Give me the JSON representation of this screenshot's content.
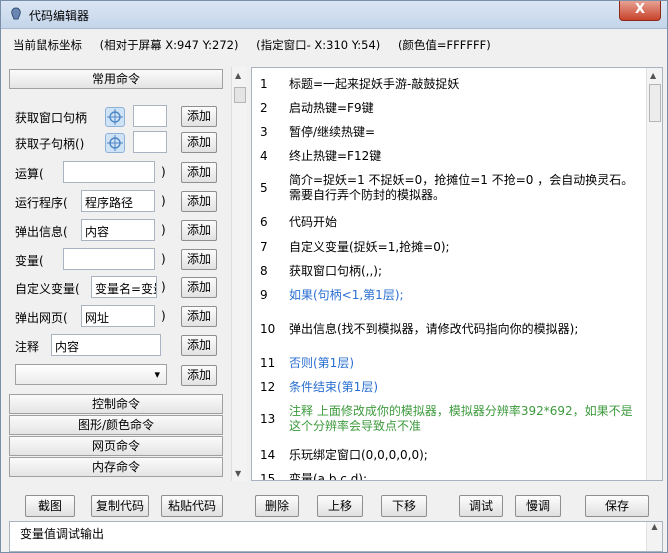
{
  "window": {
    "title": "代码编辑器",
    "close_label": "X"
  },
  "coords": {
    "label": "当前鼠标坐标",
    "screen": "(相对于屏幕 X:947 Y:272)",
    "window": "(指定窗口- X:310 Y:54)",
    "color": "(颜色值=FFFFFF)"
  },
  "sections": {
    "common": "常用命令",
    "control": "控制命令",
    "graphics": "图形/颜色命令",
    "web": "网页命令",
    "memory": "内存命令"
  },
  "commands": {
    "get_window": {
      "label": "获取窗口句柄",
      "add": "添加"
    },
    "get_child": {
      "label": "获取子句柄()",
      "add": "添加"
    },
    "compute": {
      "label": "运算(",
      "close": ")",
      "add": "添加"
    },
    "run_program": {
      "label": "运行程序(",
      "value": "程序路径",
      "close": ")",
      "add": "添加"
    },
    "popup_info": {
      "label": "弹出信息(",
      "value": "内容",
      "close": ")",
      "add": "添加"
    },
    "variable": {
      "label": "变量(",
      "close": ")",
      "add": "添加"
    },
    "custom_var": {
      "label": "自定义变量(",
      "value": "变量名=变量",
      "close": ")",
      "add": "添加"
    },
    "popup_web": {
      "label": "弹出网页(",
      "value": "网址",
      "close": ")",
      "add": "添加"
    },
    "comment": {
      "label": "注释",
      "value": "内容",
      "add": "添加"
    },
    "dropdown": {
      "value": "",
      "add": "添加"
    }
  },
  "code_lines": [
    {
      "num": "1",
      "text": "标题=一起来捉妖手游-敲鼓捉妖",
      "color": "black"
    },
    {
      "num": "2",
      "text": "启动热键=F9键",
      "color": "black"
    },
    {
      "num": "3",
      "text": "暂停/继续热键=",
      "color": "black"
    },
    {
      "num": "4",
      "text": "终止热键=F12键",
      "color": "black"
    },
    {
      "num": "5",
      "text": "简介=捉妖=1 不捉妖=0，抢摊位=1 不抢=0 ，会自动换灵石。需要自行弄个防封的模拟器。",
      "color": "black"
    },
    {
      "num": "6",
      "text": "代码开始",
      "color": "black"
    },
    {
      "num": "7",
      "text": "自定义变量(捉妖=1,抢摊=0);",
      "color": "black"
    },
    {
      "num": "8",
      "text": "获取窗口句柄(,,);",
      "color": "black"
    },
    {
      "num": "9",
      "text": "如果(句柄<1,第1层);",
      "color": "blue"
    },
    {
      "num": "10",
      "text": "弹出信息(找不到模拟器，请修改代码指向你的模拟器);",
      "color": "black"
    },
    {
      "num": "11",
      "text": "否则(第1层)",
      "color": "blue"
    },
    {
      "num": "12",
      "text": "条件结束(第1层)",
      "color": "blue"
    },
    {
      "num": "13",
      "text": "注释 上面修改成你的模拟器，模拟器分辨率392*692，如果不是这个分辨率会导致点不准",
      "color": "green"
    },
    {
      "num": "14",
      "text": "乐玩绑定窗口(0,0,0,0,0);",
      "color": "black"
    },
    {
      "num": "15",
      "text": "变量(a,b,c,d);",
      "color": "black"
    }
  ],
  "toolbar": {
    "screenshot": "截图",
    "copy_code": "复制代码",
    "paste_code": "粘贴代码",
    "delete": "删除",
    "move_up": "上移",
    "move_down": "下移",
    "debug": "调试",
    "slow_debug": "慢调",
    "save": "保存"
  },
  "output": {
    "label": "变量值调试输出"
  },
  "icons": {
    "app": "app-icon",
    "target": "crosshair-target-icon",
    "dropdown": "chevron-down-icon"
  }
}
